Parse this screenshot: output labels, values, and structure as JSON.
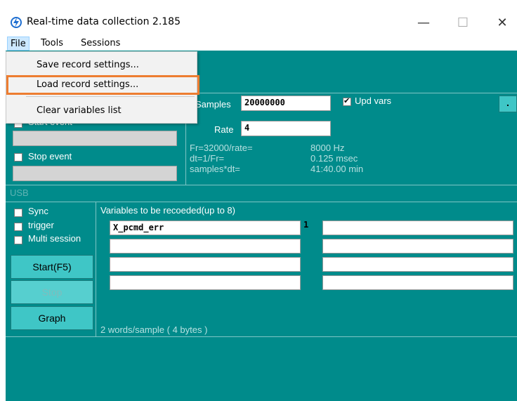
{
  "window": {
    "title": "Real-time data collection 2.185",
    "minimize_glyph": "—",
    "maximize_glyph": "☐",
    "close_glyph": "✕",
    "icon": "app-logo-icon"
  },
  "menu": {
    "file": "File",
    "tools": "Tools",
    "sessions": "Sessions"
  },
  "file_menu": {
    "save": "Save record settings...",
    "load": "Load record settings...",
    "clear": "Clear variables list"
  },
  "trigger_panel": {
    "start_event": "Start event",
    "stop_event": "Stop event",
    "start_checked": false,
    "stop_checked": false
  },
  "sampling": {
    "samples_label": "Samples",
    "samples_value": "20000000",
    "upd_vars_label": "Upd vars",
    "upd_vars_checked": true,
    "more_button": ".",
    "rate_label": "Rate",
    "rate_value": "4",
    "fr_label": "Fr=32000/rate=",
    "fr_value": "8000 Hz",
    "dt_label": "dt=1/Fr=",
    "dt_value": "0.125 msec",
    "total_label": "samples*dt=",
    "total_value": "41:40.00 min"
  },
  "usb": {
    "label": "USB",
    "sync": "Sync",
    "trigger": "trigger",
    "multi_session": "Multi session",
    "start_button": "Start(F5)",
    "stop_button": "Stop",
    "graph_button": "Graph"
  },
  "variables": {
    "header": "Variables to be recoeded(up to 8)",
    "left_column": [
      "X_pcmd_err",
      "",
      "",
      ""
    ],
    "right_column": [
      "",
      "",
      "",
      ""
    ],
    "index_marker": "1",
    "footer": "2 words/sample ( 4 bytes )"
  },
  "colors": {
    "panel": "#008b8b",
    "highlight": "#ed7d31"
  }
}
